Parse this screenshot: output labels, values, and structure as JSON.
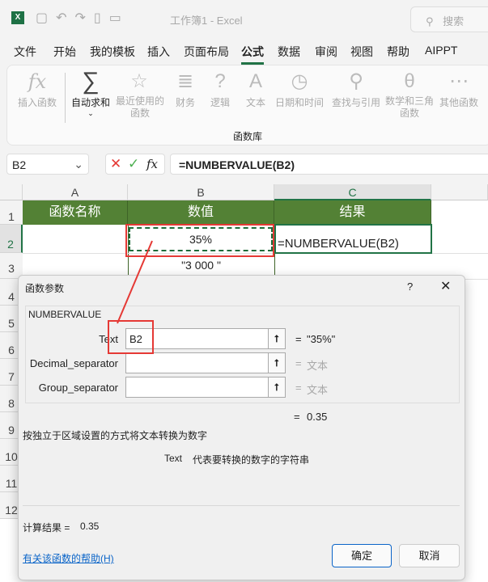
{
  "titlebar": {
    "title": "工作簿1  -  Excel",
    "search": "搜索"
  },
  "tabs": [
    "文件",
    "开始",
    "我的模板",
    "插入",
    "页面布局",
    "公式",
    "数据",
    "审阅",
    "视图",
    "帮助",
    "AIPPT"
  ],
  "active_tab": "公式",
  "ribbon": {
    "items": [
      {
        "icon": "fx",
        "label": "插入函数"
      },
      {
        "icon": "∑",
        "label": "自动求和"
      },
      {
        "icon": "☆",
        "label": "最近使用的函数"
      },
      {
        "icon": "≣",
        "label": "财务"
      },
      {
        "icon": "?",
        "label": "逻辑"
      },
      {
        "icon": "A",
        "label": "文本"
      },
      {
        "icon": "◷",
        "label": "日期和时间"
      },
      {
        "icon": "⚲",
        "label": "查找与引用"
      },
      {
        "icon": "θ",
        "label": "数学和三角函数"
      },
      {
        "icon": "⋯",
        "label": "其他函数"
      }
    ],
    "group": "函数库"
  },
  "formula_bar": {
    "name_box": "B2",
    "formula": "=NUMBERVALUE(B2)"
  },
  "sheet": {
    "columns": [
      "A",
      "B",
      "C"
    ],
    "rows": [
      "1",
      "2",
      "3",
      "4",
      "5",
      "6",
      "7",
      "8",
      "9",
      "10",
      "11",
      "12"
    ],
    "headers": [
      "函数名称",
      "数值",
      "结果"
    ],
    "b2": "35%",
    "c2": "=NUMBERVALUE(B2)",
    "b3": "\"3 000 \""
  },
  "dialog": {
    "title": "函数参数",
    "help_q": "?",
    "function": "NUMBERVALUE",
    "args": [
      {
        "label": "Text",
        "value": "B2",
        "result": "\"35%\""
      },
      {
        "label": "Decimal_separator",
        "value": "",
        "result": "文本"
      },
      {
        "label": "Group_separator",
        "value": "",
        "result": "文本"
      }
    ],
    "eq": "=",
    "overall": "0.35",
    "description": "按独立于区域设置的方式将文本转换为数字",
    "arg_desc_name": "Text",
    "arg_desc": "代表要转换的数字的字符串",
    "calc_label": "计算结果 =",
    "calc_value": "0.35",
    "help_link": "有关该函数的帮助(H)",
    "ok": "确定",
    "cancel": "取消"
  },
  "colors": {
    "accent": "#217346",
    "header_fill": "#538135",
    "annotation": "#e53935"
  }
}
